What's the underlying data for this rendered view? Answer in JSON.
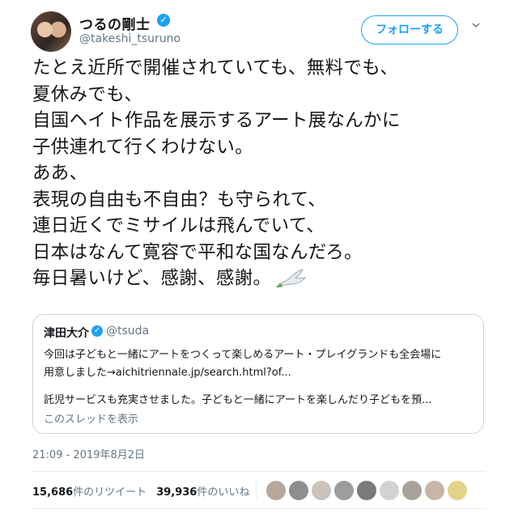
{
  "author": {
    "name": "つるの剛士",
    "handle": "@takeshi_tsuruno",
    "verified_icon": "check-icon",
    "follow_label": "フォローする"
  },
  "tweet": {
    "lines": [
      "たとえ近所で開催されていても、無料でも、",
      "夏休みでも、",
      "自国ヘイト作品を展示するアート展なんかに",
      "子供連れて行くわけない。",
      "ああ、",
      "表現の自由も不自由？も守られて、",
      "連日近くでミサイルは飛んでいて、",
      "日本はなんて寛容で平和な国なんだろ。",
      "毎日暑いけど、感謝、感謝。"
    ],
    "emoji": "dove-icon"
  },
  "quote": {
    "name": "津田大介",
    "handle": "@tsuda",
    "line1": "今回は子どもと一緒にアートをつくって楽しめるアート・プレイグランドも全会場に",
    "line2": "用意しました→aichitriennale.jp/search.html?of...",
    "line3": "託児サービスも充実させました。子どもと一緒にアートを楽しんだり子どもを預...",
    "show_thread": "このスレッドを表示"
  },
  "meta": {
    "timestamp": "21:09 - 2019年8月2日",
    "retweets_count": "15,686",
    "retweets_label": "件のリツイート",
    "likes_count": "39,936",
    "likes_label": "件のいいね"
  },
  "colors": {
    "accent": "#1da1f2",
    "muted": "#657786"
  }
}
